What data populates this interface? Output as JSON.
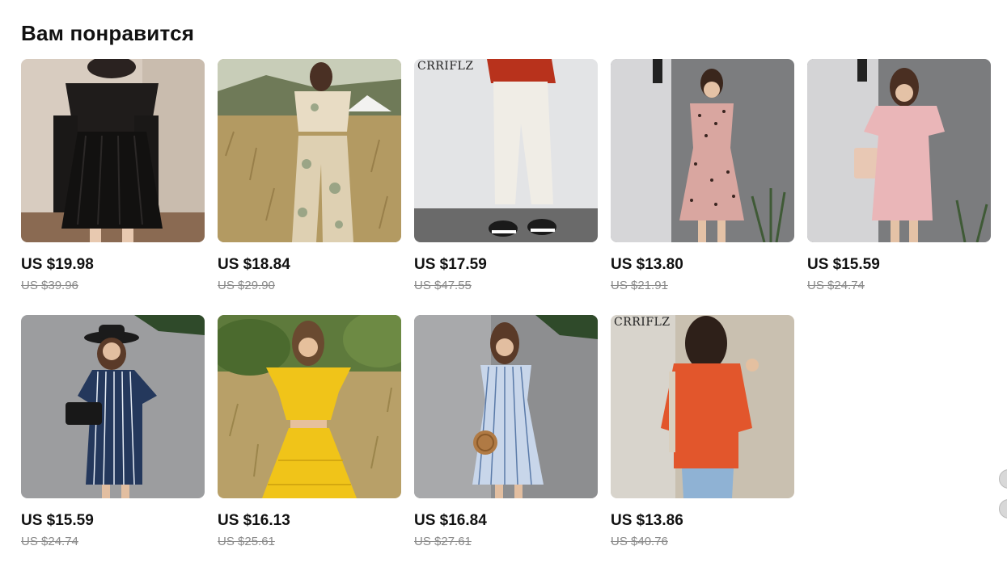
{
  "section": {
    "title": "Вам понравится"
  },
  "products": [
    {
      "price": "US $19.98",
      "old_price": "US $39.96",
      "brand": "",
      "desc": "black gothic skirt outfit"
    },
    {
      "price": "US $18.84",
      "old_price": "US $29.90",
      "brand": "",
      "desc": "floral two-piece set"
    },
    {
      "price": "US $17.59",
      "old_price": "US $47.55",
      "brand": "CRRIFLZ",
      "desc": "white trousers"
    },
    {
      "price": "US $13.80",
      "old_price": "US $21.91",
      "brand": "",
      "desc": "pink leopard dress"
    },
    {
      "price": "US $15.59",
      "old_price": "US $24.74",
      "brand": "",
      "desc": "pink v-neck dress"
    },
    {
      "price": "US $15.59",
      "old_price": "US $24.74",
      "brand": "",
      "desc": "navy striped dress"
    },
    {
      "price": "US $16.13",
      "old_price": "US $25.61",
      "brand": "",
      "desc": "yellow ruffle set"
    },
    {
      "price": "US $16.84",
      "old_price": "US $27.61",
      "brand": "",
      "desc": "blue striped dress"
    },
    {
      "price": "US $13.86",
      "old_price": "US $40.76",
      "brand": "CRRIFLZ",
      "desc": "orange oversized tee"
    }
  ]
}
